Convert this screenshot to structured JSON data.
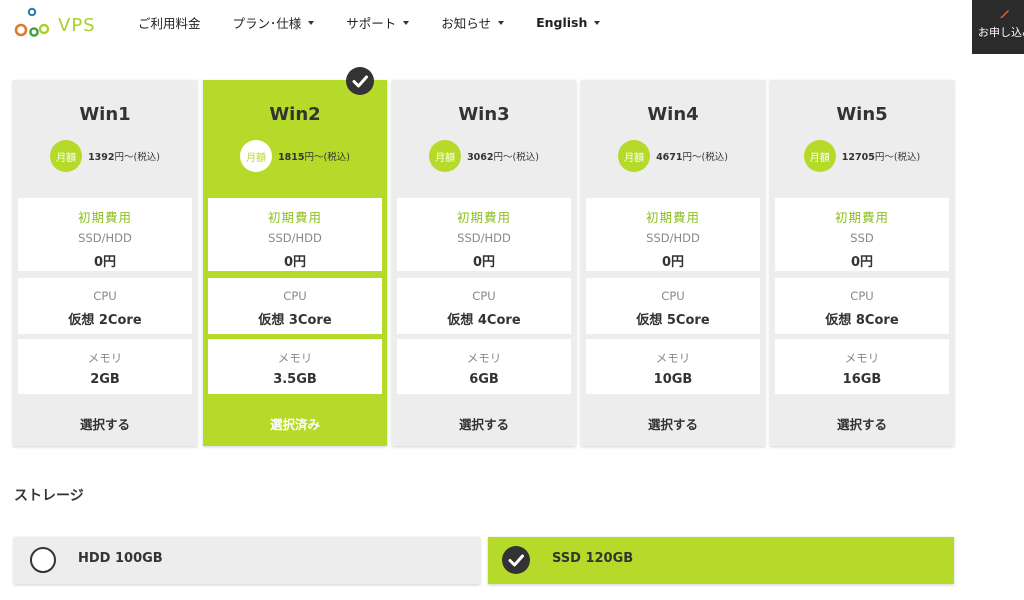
{
  "header": {
    "logo_text": "VPS",
    "nav": [
      {
        "label": "ご利用料金",
        "has_dropdown": false
      },
      {
        "label": "プラン･仕様",
        "has_dropdown": true
      },
      {
        "label": "サポート",
        "has_dropdown": true
      },
      {
        "label": "お知らせ",
        "has_dropdown": true
      },
      {
        "label": "English",
        "has_dropdown": true
      }
    ],
    "apply_button": "お申し込み"
  },
  "plans": [
    {
      "name": "Win1",
      "badge": "月額",
      "price": "1392",
      "price_suffix": "円〜(税込)",
      "init_label": "初期費用",
      "disk": "SSD/HDD",
      "init_value": "0円",
      "cpu_label": "CPU",
      "cpu_value": "仮想 2Core",
      "mem_label": "メモリ",
      "mem_value": "2GB",
      "button": "選択する",
      "selected": false
    },
    {
      "name": "Win2",
      "badge": "月額",
      "price": "1815",
      "price_suffix": "円〜(税込)",
      "init_label": "初期費用",
      "disk": "SSD/HDD",
      "init_value": "0円",
      "cpu_label": "CPU",
      "cpu_value": "仮想 3Core",
      "mem_label": "メモリ",
      "mem_value": "3.5GB",
      "button": "選択済み",
      "selected": true
    },
    {
      "name": "Win3",
      "badge": "月額",
      "price": "3062",
      "price_suffix": "円〜(税込)",
      "init_label": "初期費用",
      "disk": "SSD/HDD",
      "init_value": "0円",
      "cpu_label": "CPU",
      "cpu_value": "仮想 4Core",
      "mem_label": "メモリ",
      "mem_value": "6GB",
      "button": "選択する",
      "selected": false
    },
    {
      "name": "Win4",
      "badge": "月額",
      "price": "4671",
      "price_suffix": "円〜(税込)",
      "init_label": "初期費用",
      "disk": "SSD/HDD",
      "init_value": "0円",
      "cpu_label": "CPU",
      "cpu_value": "仮想 5Core",
      "mem_label": "メモリ",
      "mem_value": "10GB",
      "button": "選択する",
      "selected": false
    },
    {
      "name": "Win5",
      "badge": "月額",
      "price": "12705",
      "price_suffix": "円〜(税込)",
      "init_label": "初期費用",
      "disk": "SSD",
      "init_value": "0円",
      "cpu_label": "CPU",
      "cpu_value": "仮想 8Core",
      "mem_label": "メモリ",
      "mem_value": "16GB",
      "button": "選択する",
      "selected": false
    }
  ],
  "storage": {
    "title": "ストレージ",
    "options": [
      {
        "label": "HDD 100GB",
        "selected": false
      },
      {
        "label": "SSD 120GB",
        "selected": true
      }
    ]
  },
  "colors": {
    "accent": "#b6da2a",
    "dark": "#333333",
    "panel": "#ededed"
  },
  "icons": [
    "logo-rings-icon",
    "chevron-down-icon",
    "pencil-icon",
    "check-icon",
    "radio-empty-icon"
  ]
}
